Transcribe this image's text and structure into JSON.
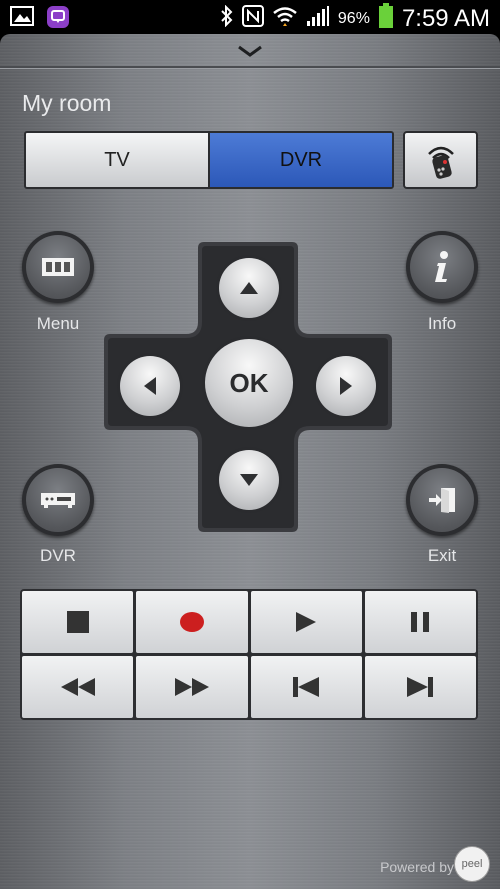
{
  "status_bar": {
    "battery_percent": "96%",
    "time": "7:59 AM",
    "icons_left": [
      "image-icon",
      "chat-app-icon"
    ],
    "icons_right": [
      "bluetooth-icon",
      "nfc-icon",
      "wifi-icon",
      "signal-icon",
      "battery-icon"
    ]
  },
  "remote": {
    "room_title": "My room",
    "device_tabs": [
      {
        "label": "TV",
        "selected": false
      },
      {
        "label": "DVR",
        "selected": true
      }
    ],
    "accent_color": "#3a67c7",
    "side_buttons": {
      "menu_label": "Menu",
      "info_label": "Info",
      "dvr_label": "DVR",
      "exit_label": "Exit"
    },
    "dpad": {
      "ok_label": "OK"
    },
    "media_buttons": [
      "stop-icon",
      "record-icon",
      "play-icon",
      "pause-icon",
      "rewind-icon",
      "fast-forward-icon",
      "previous-icon",
      "next-icon"
    ],
    "record_color": "#cc1f1f"
  },
  "footer": {
    "powered_by": "Powered by",
    "logo_text": "peel"
  }
}
